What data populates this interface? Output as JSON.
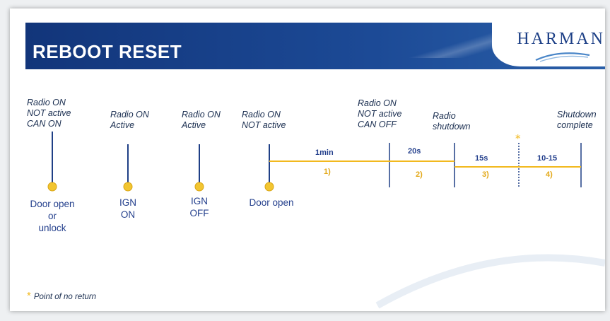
{
  "slide": {
    "title": "REBOOT RESET",
    "logo": "HARMAN"
  },
  "states": [
    {
      "lines": [
        "Radio ON",
        "NOT active",
        "CAN ON"
      ]
    },
    {
      "lines": [
        "Radio ON",
        "Active"
      ]
    },
    {
      "lines": [
        "Radio ON",
        "Active"
      ]
    },
    {
      "lines": [
        "Radio ON",
        "NOT active"
      ]
    },
    {
      "lines": [
        "Radio ON",
        "NOT active",
        "CAN OFF"
      ]
    },
    {
      "lines": [
        "Radio",
        "shutdown"
      ]
    },
    {
      "lines": [
        "Shutdown",
        "complete"
      ]
    }
  ],
  "events": [
    {
      "lines": [
        "Door open",
        "or",
        "unlock"
      ]
    },
    {
      "lines": [
        "IGN",
        "ON"
      ]
    },
    {
      "lines": [
        "IGN",
        "OFF"
      ]
    },
    {
      "lines": [
        "Door open"
      ]
    }
  ],
  "segments": [
    {
      "duration": "1min",
      "step": "1)"
    },
    {
      "duration": "20s",
      "step": "2)"
    },
    {
      "duration": "15s",
      "step": "3)"
    },
    {
      "duration": "10-15",
      "step": "4)"
    }
  ],
  "marker_symbol": "*",
  "footnote": {
    "symbol": "*",
    "text": "Point of no return"
  },
  "colors": {
    "header": "#1c4a96",
    "text_blue": "#233f8c",
    "accent_yellow": "#f2b91e",
    "line_blue": "#1f3f86"
  }
}
